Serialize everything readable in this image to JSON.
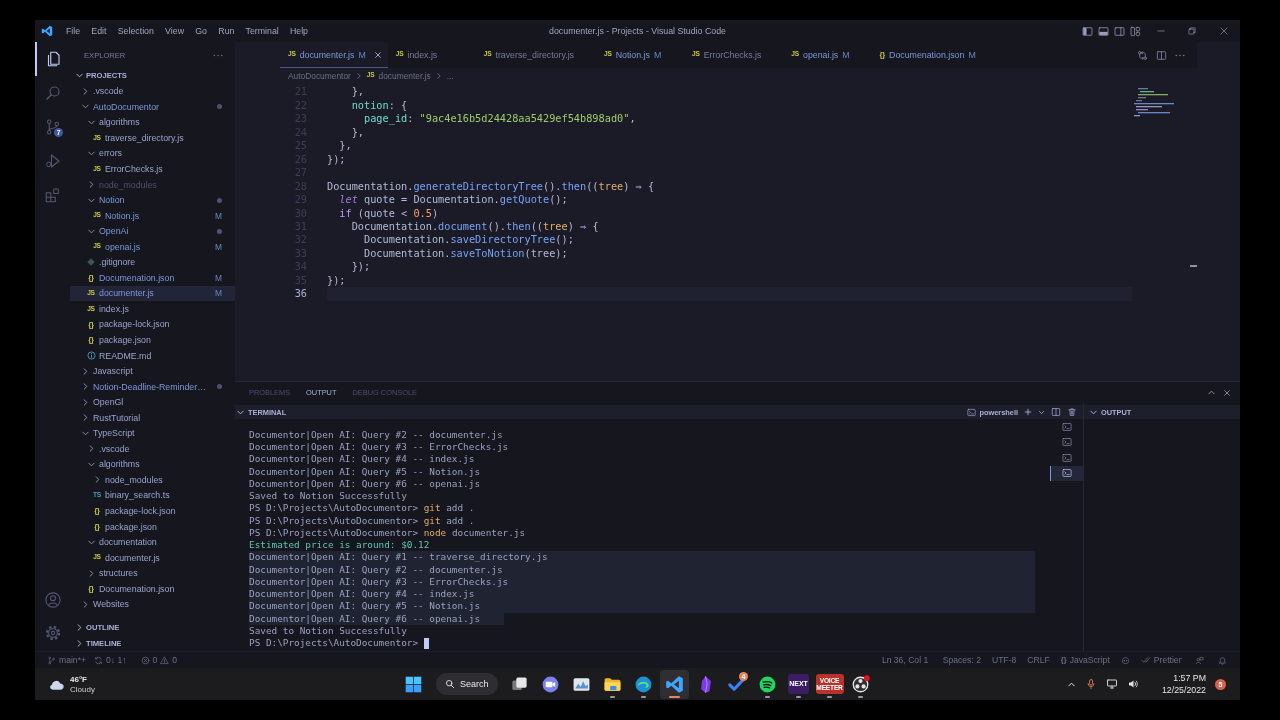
{
  "title_bar": {
    "menu": [
      "File",
      "Edit",
      "Selection",
      "View",
      "Go",
      "Run",
      "Terminal",
      "Help"
    ],
    "title": "documenter.js - Projects - Visual Studio Code"
  },
  "activity_bar": {
    "items": [
      {
        "kind": "explorer",
        "selected": true
      },
      {
        "kind": "search",
        "selected": false
      },
      {
        "kind": "source-control",
        "selected": false,
        "badge": "7"
      },
      {
        "kind": "run",
        "selected": false
      },
      {
        "kind": "extensions",
        "selected": false
      }
    ]
  },
  "sidebar": {
    "title": "EXPLORER",
    "section": {
      "label": "PROJECTS",
      "expanded": true
    },
    "tree": [
      {
        "label": ".vscode",
        "kind": "folder",
        "expanded": false,
        "modified": false,
        "selected": false,
        "ignored": false
      },
      {
        "label": "AutoDocumentor",
        "kind": "folder",
        "expanded": true,
        "modified": true,
        "selected": false,
        "ignored": false,
        "children": [
          {
            "label": "algorithms",
            "kind": "folder",
            "expanded": true,
            "modified": false,
            "selected": false,
            "ignored": false,
            "children": [
              {
                "label": "traverse_directory.js",
                "kind": "js",
                "glyph": "JS",
                "modified": false,
                "selected": false,
                "ignored": false
              }
            ]
          },
          {
            "label": "errors",
            "kind": "folder",
            "expanded": true,
            "modified": false,
            "selected": false,
            "ignored": false,
            "children": [
              {
                "label": "ErrorChecks.js",
                "kind": "js",
                "glyph": "JS",
                "modified": false,
                "selected": false,
                "ignored": false
              }
            ]
          },
          {
            "label": "node_modules",
            "kind": "folder",
            "expanded": false,
            "modified": false,
            "selected": false,
            "ignored": true
          },
          {
            "label": "Notion",
            "kind": "folder",
            "expanded": true,
            "modified": true,
            "selected": false,
            "ignored": false,
            "children": [
              {
                "label": "Notion.js",
                "kind": "js",
                "glyph": "JS",
                "status": "M",
                "modified": true,
                "selected": false,
                "ignored": false
              }
            ]
          },
          {
            "label": "OpenAi",
            "kind": "folder",
            "expanded": true,
            "modified": true,
            "selected": false,
            "ignored": false,
            "children": [
              {
                "label": "openai.js",
                "kind": "js",
                "glyph": "JS",
                "status": "M",
                "modified": true,
                "selected": false,
                "ignored": false
              }
            ]
          },
          {
            "label": ".gitignore",
            "kind": "git",
            "modified": false,
            "selected": false,
            "ignored": false
          },
          {
            "label": "Documenation.json",
            "kind": "json",
            "glyph": "{}",
            "status": "M",
            "modified": true,
            "selected": false,
            "ignored": false
          },
          {
            "label": "documenter.js",
            "kind": "js",
            "glyph": "JS",
            "status": "M",
            "modified": true,
            "selected": true,
            "ignored": false
          },
          {
            "label": "index.js",
            "kind": "js",
            "glyph": "JS",
            "modified": false,
            "selected": false,
            "ignored": false
          },
          {
            "label": "package-lock.json",
            "kind": "json",
            "glyph": "{}",
            "modified": false,
            "selected": false,
            "ignored": false
          },
          {
            "label": "package.json",
            "kind": "json",
            "glyph": "{}",
            "modified": false,
            "selected": false,
            "ignored": false
          },
          {
            "label": "README.md",
            "kind": "markdown",
            "modified": false,
            "selected": false,
            "ignored": false
          }
        ]
      },
      {
        "label": "Javascript",
        "kind": "folder",
        "expanded": false,
        "modified": false,
        "selected": false,
        "ignored": false
      },
      {
        "label": "Notion-Deadline-Reminder…",
        "kind": "folder",
        "expanded": false,
        "modified": true,
        "selected": false,
        "ignored": false
      },
      {
        "label": "OpenGl",
        "kind": "folder",
        "expanded": false,
        "modified": false,
        "selected": false,
        "ignored": false
      },
      {
        "label": "RustTutorial",
        "kind": "folder",
        "expanded": false,
        "modified": false,
        "selected": false,
        "ignored": false
      },
      {
        "label": "TypeScript",
        "kind": "folder",
        "expanded": true,
        "modified": false,
        "selected": false,
        "ignored": false,
        "children": [
          {
            "label": ".vscode",
            "kind": "folder",
            "expanded": false,
            "modified": false,
            "selected": false,
            "ignored": false
          },
          {
            "label": "algorithms",
            "kind": "folder",
            "expanded": true,
            "modified": false,
            "selected": false,
            "ignored": false,
            "children": [
              {
                "label": "node_modules",
                "kind": "folder",
                "expanded": false,
                "modified": false,
                "selected": false,
                "ignored": false
              },
              {
                "label": "binary_search.ts",
                "kind": "ts",
                "glyph": "TS",
                "modified": false,
                "selected": false,
                "ignored": false
              },
              {
                "label": "package-lock.json",
                "kind": "json",
                "glyph": "{}",
                "modified": false,
                "selected": false,
                "ignored": false
              },
              {
                "label": "package.json",
                "kind": "json",
                "glyph": "{}",
                "modified": false,
                "selected": false,
                "ignored": false
              }
            ]
          },
          {
            "label": "documentation",
            "kind": "folder",
            "expanded": true,
            "modified": false,
            "selected": false,
            "ignored": false,
            "children": [
              {
                "label": "documenter.js",
                "kind": "js",
                "glyph": "JS",
                "modified": false,
                "selected": false,
                "ignored": false
              }
            ]
          },
          {
            "label": "structures",
            "kind": "folder",
            "expanded": false,
            "modified": false,
            "selected": false,
            "ignored": false
          },
          {
            "label": "Documenation.json",
            "kind": "json",
            "glyph": "{}",
            "modified": false,
            "selected": false,
            "ignored": false
          }
        ]
      },
      {
        "label": "Websites",
        "kind": "folder",
        "expanded": false,
        "modified": false,
        "selected": false,
        "ignored": false
      }
    ],
    "footer_sections": [
      {
        "label": "OUTLINE",
        "expanded": false
      },
      {
        "label": "TIMELINE",
        "expanded": false
      }
    ]
  },
  "editor": {
    "tabs": [
      {
        "label": "documenter.js",
        "kind": "js",
        "glyph": "JS",
        "status": "M",
        "modified": true,
        "selected": true
      },
      {
        "label": "index.js",
        "kind": "js",
        "glyph": "JS",
        "modified": false,
        "selected": false
      },
      {
        "label": "traverse_directory.js",
        "kind": "js",
        "glyph": "JS",
        "modified": false,
        "selected": false
      },
      {
        "label": "Notion.js",
        "kind": "js",
        "glyph": "JS",
        "status": "M",
        "modified": true,
        "selected": false
      },
      {
        "label": "ErrorChecks.js",
        "kind": "js",
        "glyph": "JS",
        "modified": false,
        "selected": false
      },
      {
        "label": "openai.js",
        "kind": "js",
        "glyph": "JS",
        "status": "M",
        "modified": true,
        "selected": false
      },
      {
        "label": "Documenation.json",
        "kind": "json",
        "glyph": "{}",
        "status": "M",
        "modified": true,
        "selected": false
      }
    ],
    "breadcrumbs": [
      {
        "label": "AutoDocumentor"
      },
      {
        "label": "documenter.js",
        "kind": "js",
        "glyph": "JS"
      },
      {
        "label": "..."
      }
    ],
    "lines": [
      {
        "number": "21",
        "current": false,
        "tokens": [
          {
            "text": "    },",
            "kind": "plain"
          }
        ]
      },
      {
        "number": "22",
        "current": false,
        "tokens": [
          {
            "text": "    notion",
            "kind": "property"
          },
          {
            "text": ": {",
            "kind": "plain"
          }
        ]
      },
      {
        "number": "23",
        "current": false,
        "tokens": [
          {
            "text": "      page_id",
            "kind": "property"
          },
          {
            "text": ": ",
            "kind": "plain"
          },
          {
            "text": "\"9ac4e16b5d24428aa5429ef54b898ad0\"",
            "kind": "string"
          },
          {
            "text": ",",
            "kind": "plain"
          }
        ]
      },
      {
        "number": "24",
        "current": false,
        "tokens": [
          {
            "text": "    },",
            "kind": "plain"
          }
        ]
      },
      {
        "number": "25",
        "current": false,
        "tokens": [
          {
            "text": "  },",
            "kind": "plain"
          }
        ]
      },
      {
        "number": "26",
        "current": false,
        "tokens": [
          {
            "text": "});",
            "kind": "plain"
          }
        ]
      },
      {
        "number": "27",
        "current": false
      },
      {
        "number": "28",
        "current": false,
        "tokens": [
          {
            "text": "Documentation.",
            "kind": "plain"
          },
          {
            "text": "generateDirectoryTree",
            "kind": "method"
          },
          {
            "text": "().",
            "kind": "plain"
          },
          {
            "text": "then",
            "kind": "method"
          },
          {
            "text": "((",
            "kind": "plain"
          },
          {
            "text": "tree",
            "kind": "param"
          },
          {
            "text": ") ",
            "kind": "plain"
          },
          {
            "text": "⇒",
            "kind": "operator"
          },
          {
            "text": " {",
            "kind": "plain"
          }
        ]
      },
      {
        "number": "29",
        "current": false,
        "tokens": [
          {
            "text": "  let",
            "kind": "storage"
          },
          {
            "text": " quote = Documentation.",
            "kind": "plain"
          },
          {
            "text": "getQuote",
            "kind": "method"
          },
          {
            "text": "();",
            "kind": "plain"
          }
        ]
      },
      {
        "number": "30",
        "current": false,
        "tokens": [
          {
            "text": "  if",
            "kind": "keyword"
          },
          {
            "text": " (quote < ",
            "kind": "plain"
          },
          {
            "text": "0.5",
            "kind": "number"
          },
          {
            "text": ")",
            "kind": "plain"
          }
        ]
      },
      {
        "number": "31",
        "current": false,
        "tokens": [
          {
            "text": "    Documentation.",
            "kind": "plain"
          },
          {
            "text": "document",
            "kind": "method"
          },
          {
            "text": "().",
            "kind": "plain"
          },
          {
            "text": "then",
            "kind": "method"
          },
          {
            "text": "((",
            "kind": "plain"
          },
          {
            "text": "tree",
            "kind": "param"
          },
          {
            "text": ") ",
            "kind": "plain"
          },
          {
            "text": "⇒",
            "kind": "operator"
          },
          {
            "text": " {",
            "kind": "plain"
          }
        ]
      },
      {
        "number": "32",
        "current": false,
        "tokens": [
          {
            "text": "      Documentation.",
            "kind": "plain"
          },
          {
            "text": "saveDirectoryTree",
            "kind": "method"
          },
          {
            "text": "();",
            "kind": "plain"
          }
        ]
      },
      {
        "number": "33",
        "current": false,
        "tokens": [
          {
            "text": "      Documentation.",
            "kind": "plain"
          },
          {
            "text": "saveToNotion",
            "kind": "method"
          },
          {
            "text": "(tree);",
            "kind": "plain"
          }
        ]
      },
      {
        "number": "34",
        "current": false,
        "tokens": [
          {
            "text": "    });",
            "kind": "plain"
          }
        ]
      },
      {
        "number": "35",
        "current": false,
        "tokens": [
          {
            "text": "});",
            "kind": "plain"
          }
        ]
      },
      {
        "number": "36",
        "current": true
      }
    ]
  },
  "panel": {
    "tabs": [
      {
        "label": "PROBLEMS",
        "selected": false
      },
      {
        "label": "OUTPUT",
        "selected": true
      },
      {
        "label": "DEBUG CONSOLE",
        "selected": false
      }
    ],
    "terminal": {
      "title": "TERMINAL",
      "expanded": true,
      "shell": "powershell",
      "instances": [
        {
          "selected": false
        },
        {
          "selected": false
        },
        {
          "selected": false
        },
        {
          "selected": true
        }
      ],
      "lines": [
        {
          "kind": "output",
          "text": "Documentor|Open AI: Query #2 -- documenter.js",
          "selected": false,
          "cursor": false
        },
        {
          "kind": "output",
          "text": "Documentor|Open AI: Query #3 -- ErrorChecks.js",
          "selected": false,
          "cursor": false
        },
        {
          "kind": "output",
          "text": "Documentor|Open AI: Query #4 -- index.js",
          "selected": false,
          "cursor": false
        },
        {
          "kind": "output",
          "text": "Documentor|Open AI: Query #5 -- Notion.js",
          "selected": false,
          "cursor": false
        },
        {
          "kind": "output",
          "text": "Documentor|Open AI: Query #6 -- openai.js",
          "selected": false,
          "cursor": false
        },
        {
          "kind": "output",
          "text": "Saved to Notion Successfully",
          "selected": false,
          "cursor": false
        },
        {
          "kind": "prompt",
          "prompt": "PS D:\\Projects\\AutoDocumentor>",
          "command": "git",
          "args": "add .",
          "selected": false,
          "cursor": false
        },
        {
          "kind": "prompt",
          "prompt": "PS D:\\Projects\\AutoDocumentor>",
          "command": "git",
          "args": "add .",
          "selected": false,
          "cursor": false
        },
        {
          "kind": "prompt",
          "prompt": "PS D:\\Projects\\AutoDocumentor>",
          "command": "node",
          "args": "documenter.js",
          "selected": false,
          "cursor": false
        },
        {
          "kind": "info",
          "text": "Estimated price is around: $0.12",
          "selected": false,
          "cursor": false
        },
        {
          "kind": "output",
          "text": "Documentor|Open AI: Query #1 -- traverse_directory.js",
          "selected": true,
          "cursor": false
        },
        {
          "kind": "output",
          "text": "Documentor|Open AI: Query #2 -- documenter.js",
          "selected": true,
          "cursor": false
        },
        {
          "kind": "output",
          "text": "Documentor|Open AI: Query #3 -- ErrorChecks.js",
          "selected": true,
          "cursor": false
        },
        {
          "kind": "output",
          "text": "Documentor|Open AI: Query #4 -- index.js",
          "selected": true,
          "cursor": false
        },
        {
          "kind": "output",
          "text": "Documentor|Open AI: Query #5 -- Notion.js",
          "selected": true,
          "cursor": false
        },
        {
          "kind": "output",
          "text": "Documentor|Open AI: Query #6 -- openai.js",
          "selected": true,
          "cursor": false
        },
        {
          "kind": "output",
          "text": "Saved to Notion Successfully",
          "selected": false,
          "cursor": false
        },
        {
          "kind": "prompt",
          "prompt": "PS D:\\Projects\\AutoDocumentor>",
          "selected": false,
          "cursor": true
        }
      ]
    },
    "output": {
      "title": "OUTPUT",
      "expanded": true
    }
  },
  "status_bar": {
    "branch": "main*+",
    "sync": "0↓ 1↑",
    "errors": "0",
    "warnings": "0",
    "position": "Ln 36, Col 1",
    "indentation": "Spaces: 2",
    "encoding": "UTF-8",
    "line_endings": "CRLF",
    "language": {
      "glyph": "{}",
      "label": "JavaScript"
    },
    "formatter": "Prettier"
  },
  "taskbar": {
    "weather": {
      "temperature": "46°F",
      "condition": "Cloudy"
    },
    "search": "Search",
    "apps": [
      {
        "kind": "task-view",
        "running": false,
        "selected": false
      },
      {
        "kind": "chat",
        "running": false,
        "selected": false
      },
      {
        "kind": "photos",
        "running": false,
        "selected": false
      },
      {
        "kind": "files",
        "running": true,
        "selected": false
      },
      {
        "kind": "browser",
        "running": true,
        "selected": false
      },
      {
        "kind": "code",
        "running": true,
        "selected": true
      },
      {
        "kind": "notes",
        "running": false,
        "selected": false
      },
      {
        "kind": "todo",
        "running": false,
        "selected": false,
        "badge": "4"
      },
      {
        "kind": "music",
        "running": true,
        "selected": false
      },
      {
        "kind": "next-logo",
        "running": true,
        "selected": false,
        "logo_text": "NEXT"
      },
      {
        "kind": "mixer-logo",
        "running": true,
        "selected": false,
        "logo_text": "VOICE MEETER"
      },
      {
        "kind": "recorder",
        "running": true,
        "selected": false
      }
    ],
    "clock": {
      "time": "1:57 PM",
      "date": "12/25/2022"
    },
    "notifications": "5"
  }
}
